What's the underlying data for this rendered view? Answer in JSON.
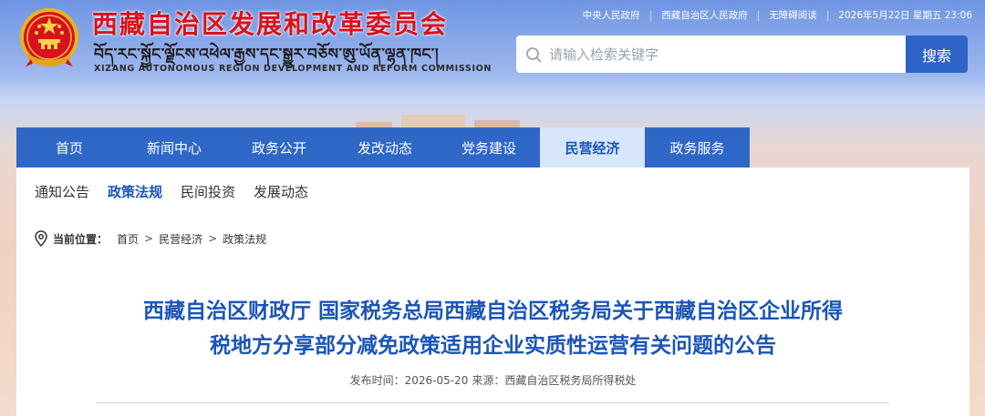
{
  "header": {
    "site_title": "西藏自治区发展和改革委员会",
    "tibetan_title": "བོད་རང་སྐྱོང་ལྗོངས་འཕེལ་རྒྱས་དང་སྒྱུར་བཅོས་ཨུ་ཡོན་ལྷན་ཁང་།",
    "english_title": "XIZANG AUTONOMOUS REGION DEVELOPMENT AND REFORM COMMISSION",
    "toplinks": [
      "中央人民政府",
      "西藏自治区人民政府",
      "无障碍阅读"
    ],
    "datetime": "2026年5月22日 星期五 23:06",
    "search_placeholder": "请输入检索关键字",
    "search_button": "搜索"
  },
  "nav": {
    "items": [
      {
        "label": "首页"
      },
      {
        "label": "新闻中心"
      },
      {
        "label": "政务公开"
      },
      {
        "label": "发改动态"
      },
      {
        "label": "党务建设"
      },
      {
        "label": "民营经济",
        "active": true
      },
      {
        "label": "政务服务"
      }
    ]
  },
  "subnav": {
    "items": [
      "通知公告",
      "政策法规",
      "民间投资",
      "发展动态"
    ],
    "active": "政策法规"
  },
  "breadcrumb": {
    "label": "当前位置：",
    "items": [
      "首页",
      "民营经济",
      "政策法规"
    ],
    "separator": ">"
  },
  "article": {
    "title_line1": "西藏自治区财政厅 国家税务总局西藏自治区税务局关于西藏自治区企业所得",
    "title_line2": "税地方分享部分减免政策适用企业实质性运营有关问题的公告",
    "publish_label": "发布时间：",
    "publish_date": "2026-05-20",
    "source_label": "来源：",
    "source": "西藏自治区税务局所得税处"
  },
  "colors": {
    "brand_red": "#d8121b",
    "nav_blue": "#2f67c7",
    "title_blue": "#1b55b8",
    "nav_active_bg": "#d7e6fb"
  }
}
